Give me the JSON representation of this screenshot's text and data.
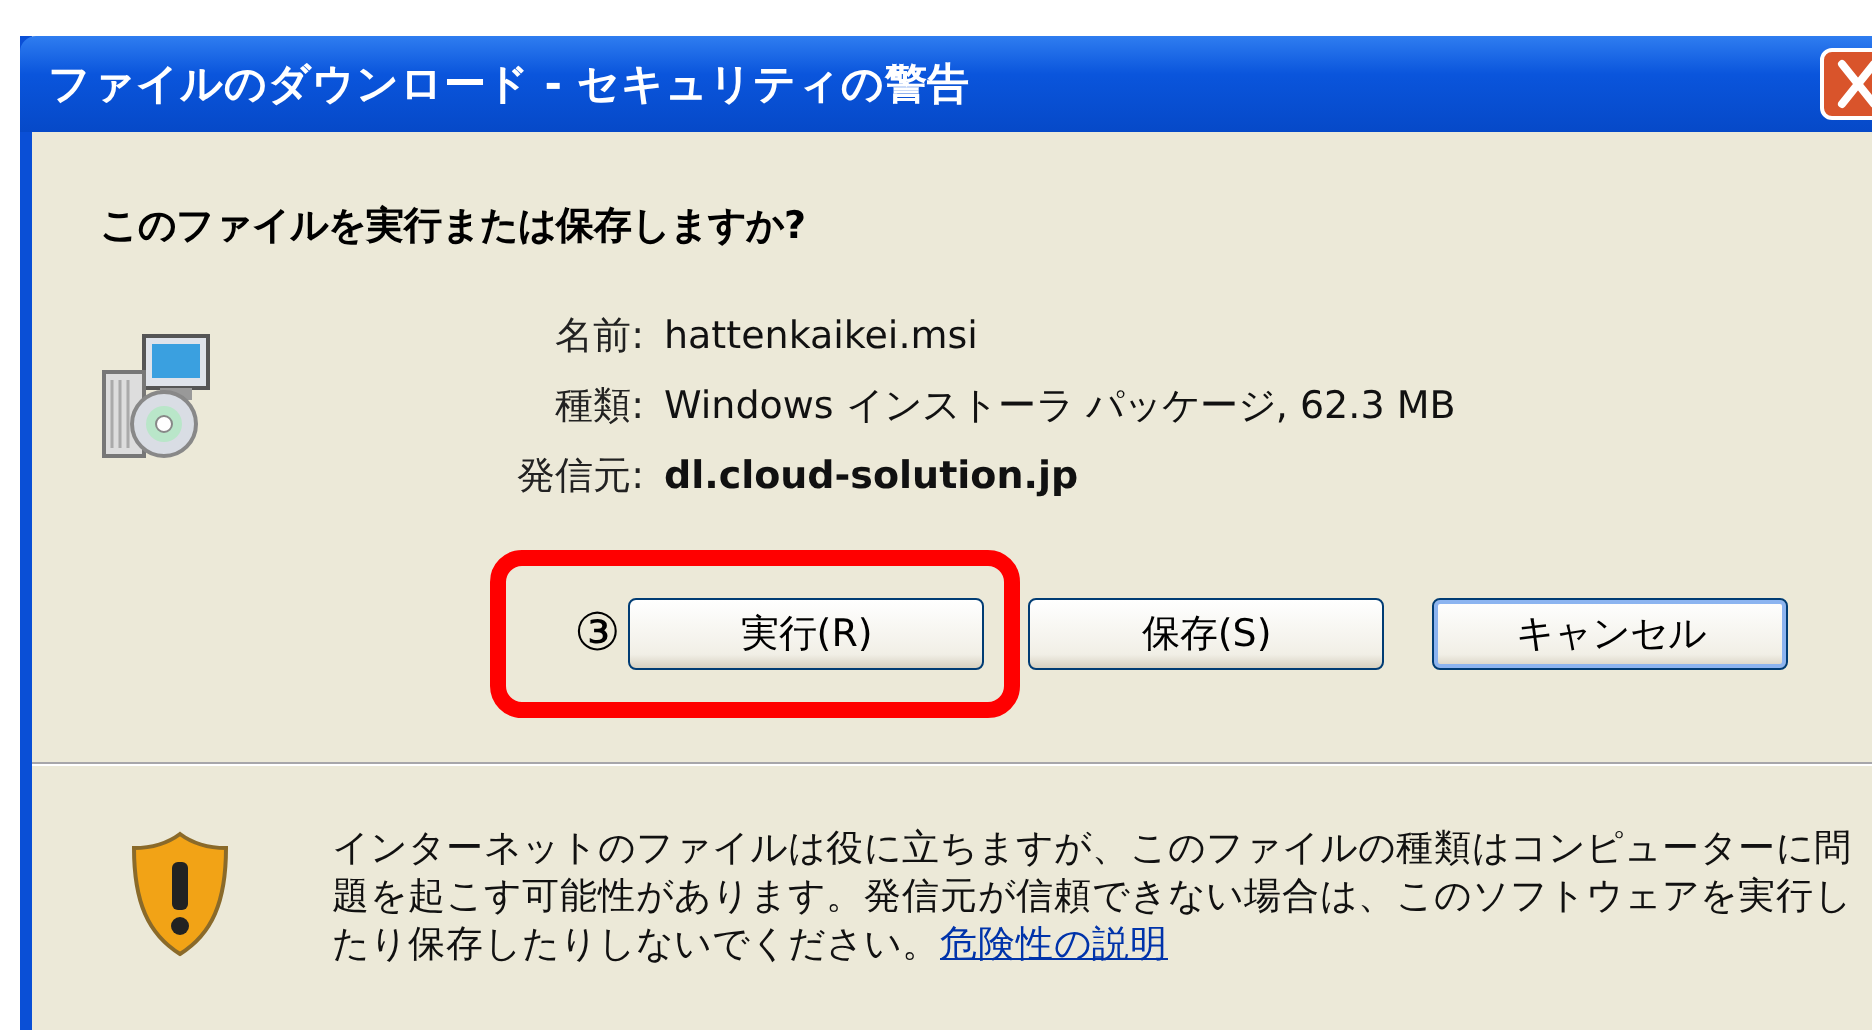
{
  "window": {
    "title": "ファイルのダウンロード - セキュリティの警告"
  },
  "question": "このファイルを実行または保存しますか?",
  "details": [
    {
      "label": "名前:",
      "value": "hattenkaikei.msi",
      "kind": "plain"
    },
    {
      "label": "種類:",
      "value": "Windows インストーラ パッケージ, 62.3 MB",
      "kind": "plain"
    },
    {
      "label": "発信元:",
      "value": "dl.cloud-solution.jp",
      "kind": "bold"
    }
  ],
  "buttons": [
    {
      "label": "実行(R)",
      "annotation": "③",
      "focused": false
    },
    {
      "label": "保存(S)",
      "focused": false
    },
    {
      "label": "キャンセル",
      "focused": true
    }
  ],
  "warning": {
    "text": "インターネットのファイルは役に立ちますが、このファイルの種類はコンピューターに問題を起こす可能性があります。発信元が信頼できない場合は、このソフトウェアを実行したり保存したりしないでください。",
    "link": "危険性の説明"
  }
}
